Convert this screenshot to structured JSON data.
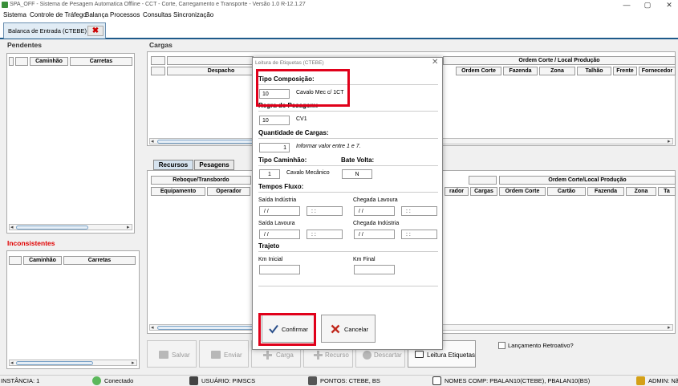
{
  "window": {
    "title": "SPA_OFF - Sistema de Pesagem Automatica Offline - CCT - Corte, Carregamento e Transporte - Versão 1.0 R-12.1.27",
    "minimize": "—",
    "restore": "▢",
    "close": "✕"
  },
  "menu": {
    "items": [
      "Sistema",
      "Controle de Tráfego",
      "Balança",
      "Processos",
      "Consultas",
      "Sincronização"
    ]
  },
  "tab": {
    "label": "Balanca de Entrada (CTEBE)",
    "close": "✖"
  },
  "pendentes": {
    "title": "Pendentes",
    "columns": [
      "Caminhão",
      "Carretas"
    ]
  },
  "inconsistentes": {
    "title": "Inconsistentes",
    "columns": [
      "Caminhão",
      "Carretas"
    ],
    "color": "#e00000"
  },
  "cargas": {
    "title": "Cargas",
    "header_top": "Ordem Corte / Local Produção",
    "columns": [
      "Despacho",
      "Ordem Corte",
      "Fazenda",
      "Zona",
      "Talhão",
      "Frente",
      "Fornecedor"
    ]
  },
  "recursos": {
    "tabs": [
      "Recursos",
      "Pesagens"
    ],
    "header_row1": [
      "Reboque/Transbordo",
      "Ordem Corte/Local Produção"
    ],
    "columns_left": [
      "Equipamento",
      "Operador"
    ],
    "columns_right": [
      "rador",
      "Cargas",
      "Ordem Corte",
      "Cartão",
      "Fazenda",
      "Zona",
      "Ta"
    ]
  },
  "toolbar": {
    "salvar": "Salvar",
    "enviar": "Enviar",
    "carga": "Carga",
    "recurso": "Recurso",
    "descartar": "Descartar",
    "leitura": "Leitura Etiquetas",
    "lancamento": "Lançamento Retroativo?"
  },
  "status": {
    "instancia": "INSTÂNCIA: 1",
    "conectado": "Conectado",
    "usuario": "USUÁRIO: PIMSCS",
    "pontos": "PONTOS: CTEBE, BS",
    "nomes": "NOMES COMP: PBALAN10(CTEBE), PBALAN10(BS)",
    "admin": "ADMIN: Não"
  },
  "modal": {
    "title": "Leitura de Etiquetas (CTEBE)",
    "close": "✕",
    "tipo_composicao": {
      "label": "Tipo Composição:",
      "value": "10",
      "desc": "Cavalo Mec c/ 1CT"
    },
    "regra_pesagem": {
      "label": "Regra de Pesagem:",
      "value": "10",
      "desc": "CV1"
    },
    "quantidade_cargas": {
      "label": "Quantidade de Cargas:",
      "value": "1",
      "hint": "Informar valor entre 1 e 7."
    },
    "tipo_caminhao": {
      "label": "Tipo Caminhão:",
      "value": "1",
      "desc": "Cavalo Mecânico"
    },
    "bate_volta": {
      "label": "Bate Volta:",
      "value": "N"
    },
    "tempos_fluxo": {
      "label": "Tempos Fluxo:",
      "saida_industria": "Saída Indústria",
      "chegada_lavoura": "Chegada Lavoura",
      "saida_lavoura": "Saída Lavoura",
      "chegada_industria": "Chegada Indústria",
      "date_mask": " / /",
      "time_mask": " : :"
    },
    "trajeto": {
      "label": "Trajeto",
      "km_inicial": "Km Inicial",
      "km_final": "Km Final"
    },
    "confirmar": "Confirmar",
    "cancelar": "Cancelar",
    "highlight_color": "#e0001a"
  }
}
